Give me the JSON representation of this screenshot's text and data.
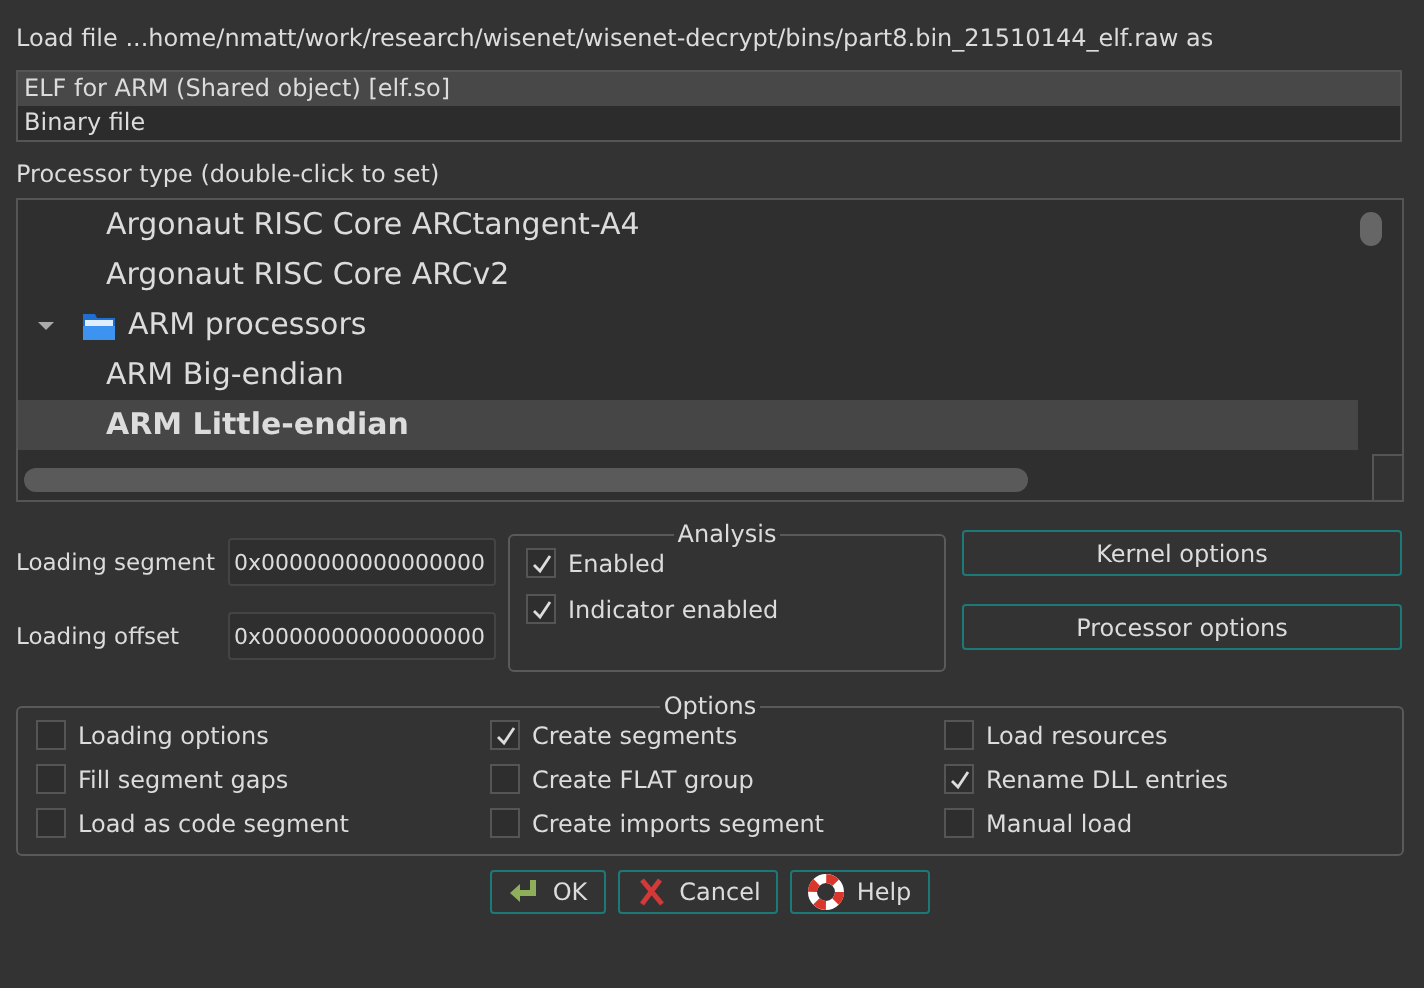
{
  "load_file_label": "Load file ...home/nmatt/work/research/wisenet/wisenet-decrypt/bins/part8.bin_21510144_elf.raw as",
  "formats": [
    {
      "label": "ELF for ARM (Shared object) [elf.so]",
      "selected": true
    },
    {
      "label": "Binary file",
      "selected": false
    }
  ],
  "processor_type_label": "Processor type (double-click to set)",
  "processors": [
    {
      "kind": "processor",
      "label": "Argonaut RISC Core ARCtangent-A4",
      "selected": false
    },
    {
      "kind": "processor",
      "label": "Argonaut RISC Core ARCv2",
      "selected": false
    },
    {
      "kind": "folder",
      "label": "ARM processors",
      "expanded": true,
      "children": [
        {
          "kind": "processor",
          "label": "ARM Big-endian",
          "selected": false
        },
        {
          "kind": "processor",
          "label": "ARM Little-endian",
          "selected": true
        }
      ]
    }
  ],
  "loading_segment": {
    "label": "Loading segment",
    "value": "0x0000000000000000"
  },
  "loading_offset": {
    "label": "Loading offset",
    "value": "0x0000000000000000"
  },
  "analysis": {
    "title": "Analysis",
    "options": [
      {
        "label": "Enabled",
        "checked": true
      },
      {
        "label": "Indicator enabled",
        "checked": true
      }
    ]
  },
  "side_buttons": [
    "Kernel options",
    "Processor options"
  ],
  "options": {
    "title": "Options",
    "items": [
      {
        "label": "Loading options",
        "checked": false
      },
      {
        "label": "Create segments",
        "checked": true
      },
      {
        "label": "Load resources",
        "checked": false
      },
      {
        "label": "Fill segment gaps",
        "checked": false
      },
      {
        "label": "Create FLAT group",
        "checked": false
      },
      {
        "label": "Rename DLL entries",
        "checked": true
      },
      {
        "label": "Load as code segment",
        "checked": false
      },
      {
        "label": "Create imports segment",
        "checked": false
      },
      {
        "label": "Manual load",
        "checked": false
      }
    ]
  },
  "buttons": [
    {
      "kind": "ok",
      "label": "OK"
    },
    {
      "kind": "cancel",
      "label": "Cancel"
    },
    {
      "kind": "help",
      "label": "Help"
    }
  ]
}
